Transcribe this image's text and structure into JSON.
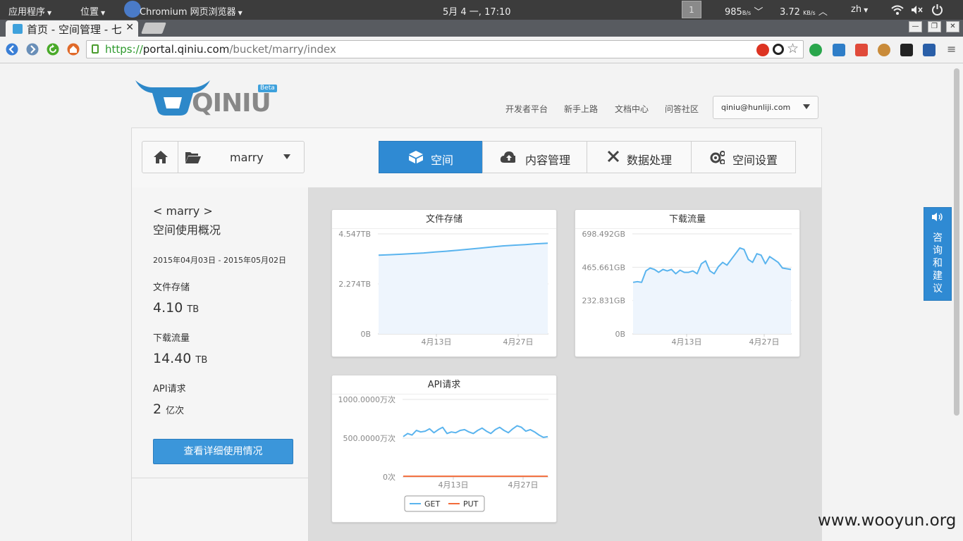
{
  "os_panel": {
    "apps": "应用程序",
    "places": "位置",
    "browser": "Chromium 网页浏览器",
    "datetime": "5月 4 一, 17:10",
    "workspace": "1",
    "net_down": "985",
    "net_down_unit": "B/s",
    "net_up": "3.72",
    "net_up_unit": "KB/s",
    "lang": "zh"
  },
  "browser": {
    "tab_title": "首页 - 空间管理 - 七",
    "url_https": "https://",
    "url_host": "portal.qiniu.com",
    "url_path": "/bucket/marry/index",
    "min": "—",
    "max": "❐",
    "close": "✕"
  },
  "header": {
    "logo_text": "QINIU",
    "beta": "Beta",
    "links": [
      "开发者平台",
      "新手上路",
      "文档中心",
      "问答社区"
    ],
    "user_email": "qiniu@hunliji.com"
  },
  "bucket_selector": {
    "name": "marry"
  },
  "nav_tabs": [
    {
      "label": "空间",
      "active": true
    },
    {
      "label": "内容管理",
      "active": false
    },
    {
      "label": "数据处理",
      "active": false
    },
    {
      "label": "空间设置",
      "active": false
    }
  ],
  "sidebar": {
    "title_line1": "< marry >",
    "title_line2": "空间使用概况",
    "date_range": "2015年04月03日 - 2015年05月02日",
    "storage_label": "文件存储",
    "storage_value": "4.10",
    "storage_unit": "TB",
    "traffic_label": "下载流量",
    "traffic_value": "14.40",
    "traffic_unit": "TB",
    "api_label": "API请求",
    "api_value": "2",
    "api_unit": "亿次",
    "detail_button": "查看详细使用情况"
  },
  "feedback": {
    "chars": [
      "咨",
      "询",
      "和",
      "建",
      "议"
    ]
  },
  "watermark": "www.wooyun.org",
  "colors": {
    "accent": "#2f8ad3",
    "line_blue": "#5ab4ee",
    "area_fill": "#eef5fd",
    "put_red": "#f26b3a"
  },
  "chart_data": [
    {
      "type": "area",
      "title": "文件存储",
      "y_ticks": [
        "4.547TB",
        "2.274TB",
        "0B"
      ],
      "x_ticks": [
        "4月13日",
        "4月27日"
      ],
      "ylim": [
        0,
        4.547
      ],
      "series": [
        {
          "values": [
            3.58,
            3.6,
            3.62,
            3.65,
            3.68,
            3.72,
            3.76,
            3.8,
            3.85,
            3.9,
            3.95,
            4.0,
            4.03,
            4.06,
            4.1,
            4.12
          ]
        }
      ]
    },
    {
      "type": "area",
      "title": "下载流量",
      "y_ticks": [
        "698.492GB",
        "465.661GB",
        "232.831GB",
        "0B"
      ],
      "x_ticks": [
        "4月13日",
        "4月27日"
      ],
      "ylim": [
        0,
        698.492
      ],
      "series": [
        {
          "values": [
            360,
            365,
            360,
            440,
            460,
            450,
            430,
            450,
            440,
            450,
            420,
            445,
            430,
            430,
            440,
            420,
            490,
            510,
            440,
            420,
            470,
            500,
            480,
            520,
            560,
            600,
            590,
            520,
            500,
            560,
            550,
            490,
            540,
            520,
            500,
            460,
            455,
            450
          ]
        }
      ]
    },
    {
      "type": "line",
      "title": "API请求",
      "y_ticks": [
        "1000.0000万次",
        "500.0000万次",
        "0次"
      ],
      "x_ticks": [
        "4月13日",
        "4月27日"
      ],
      "ylim": [
        0,
        1000
      ],
      "legend": "bottom",
      "series": [
        {
          "name": "GET",
          "color": "#5ab4ee",
          "values": [
            520,
            560,
            540,
            600,
            580,
            590,
            620,
            570,
            610,
            640,
            560,
            580,
            570,
            600,
            610,
            580,
            560,
            600,
            630,
            590,
            560,
            610,
            640,
            600,
            570,
            620,
            660,
            640,
            590,
            610,
            580,
            540,
            510,
            520
          ]
        },
        {
          "name": "PUT",
          "color": "#f26b3a",
          "values": [
            8,
            8,
            8,
            8,
            8,
            8,
            8,
            8,
            8,
            8,
            8,
            8,
            8,
            8,
            8,
            8,
            8,
            8,
            8,
            8,
            8,
            8,
            8,
            8,
            8,
            8,
            8,
            8,
            8,
            8,
            8,
            8,
            8,
            8
          ]
        }
      ]
    }
  ]
}
